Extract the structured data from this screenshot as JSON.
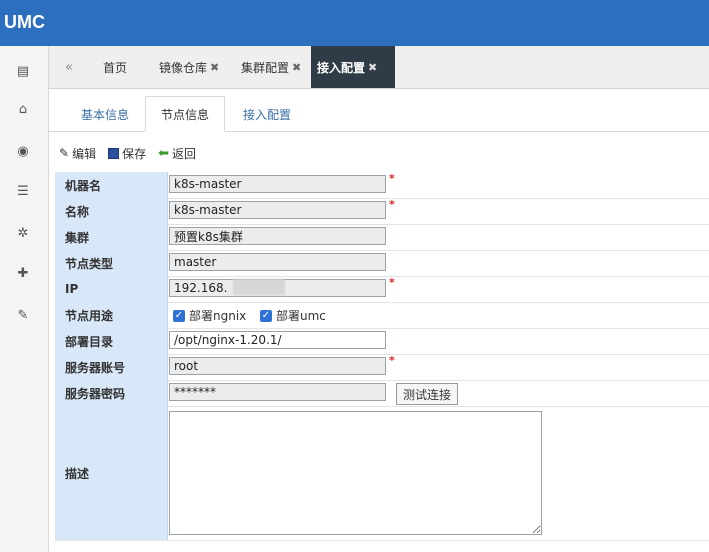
{
  "app": {
    "title": "UMC"
  },
  "sidebar": {
    "icons": [
      "id-card-icon",
      "bank-icon",
      "eye-icon",
      "list-icon",
      "gear-icon",
      "puzzle-icon",
      "wrench-icon"
    ]
  },
  "tabs": {
    "back_icon": "double-left-icon",
    "items": [
      {
        "label": "首页",
        "closable": false,
        "active": false
      },
      {
        "label": "镜像仓库",
        "closable": true,
        "active": false
      },
      {
        "label": "集群配置",
        "closable": true,
        "active": false
      },
      {
        "label": "接入配置",
        "closable": true,
        "active": true
      }
    ],
    "close_glyph": "✖"
  },
  "subtabs": [
    "基本信息",
    "节点信息",
    "接入配置"
  ],
  "subtab_active": "节点信息",
  "toolbar": {
    "edit": "编辑",
    "save": "保存",
    "back": "返回"
  },
  "form": {
    "hostname": {
      "label": "机器名",
      "value": "k8s-master",
      "required": "*"
    },
    "name": {
      "label": "名称",
      "value": "k8s-master",
      "required": "*"
    },
    "cluster": {
      "label": "集群",
      "value": "预置k8s集群"
    },
    "node_type": {
      "label": "节点类型",
      "value": "master"
    },
    "ip": {
      "label": "IP",
      "value": "192.168.",
      "required": "*"
    },
    "usage": {
      "label": "节点用途",
      "options": [
        "部署ngnix",
        "部署umc"
      ]
    },
    "deploy_dir": {
      "label": "部署目录",
      "value": "/opt/nginx-1.20.1/"
    },
    "account": {
      "label": "服务器账号",
      "value": "root",
      "required": "*"
    },
    "password": {
      "label": "服务器密码",
      "value": "*******",
      "test_button": "测试连接"
    },
    "desc": {
      "label": "描述",
      "value": ""
    }
  },
  "colors": {
    "topbar": "#2d6fbf",
    "label_bg": "#d9e8f8",
    "active_tab": "#2f3b46",
    "required": "#dd2222"
  }
}
